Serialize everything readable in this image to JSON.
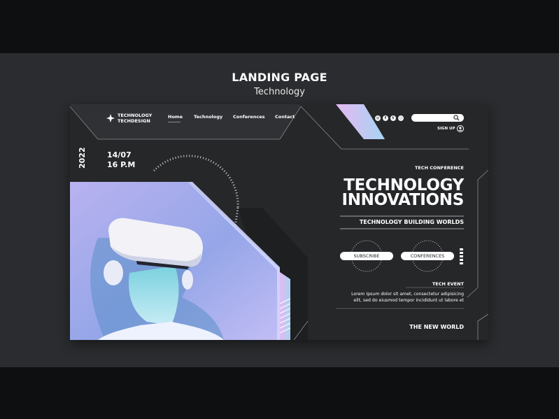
{
  "page": {
    "title": "LANDING PAGE",
    "subtitle": "Technology"
  },
  "brand": {
    "line1": "TECHNOLOGY",
    "line2": "TECHDESIGN"
  },
  "nav": [
    {
      "label": "Home"
    },
    {
      "label": "Technology"
    },
    {
      "label": "Conferences"
    },
    {
      "label": "Contact"
    }
  ],
  "social_icons": [
    "instagram-icon",
    "facebook-icon",
    "twitter-icon",
    "whatsapp-icon"
  ],
  "search": {
    "placeholder": ""
  },
  "account": {
    "signup_label": "SIGN UP"
  },
  "event": {
    "year": "2022",
    "date": "14/07",
    "time": "16 P.M"
  },
  "hero": {
    "kicker": "TECH CONFERENCE",
    "headline_line1": "TECHNOLOGY",
    "headline_line2": "INNOVATIONS",
    "tagline": "TECHNOLOGY BUILDING WORLDS",
    "subscribe_label": "SUBSCRIBE",
    "conferences_label": "CONFERENCES",
    "event_label": "TECH EVENT",
    "body_line1": "Lorem Ipsum dolor sit amet, consectetur adipisicing",
    "body_line2": "elit, sed do eiusmod tempor incididunt ut labore et",
    "footer": "THE NEW WORLD"
  },
  "colors": {
    "accent_gradient_start": "#e6b8f2",
    "accent_gradient_end": "#a6d4f2",
    "photo_bg": "#9aa7e6"
  }
}
